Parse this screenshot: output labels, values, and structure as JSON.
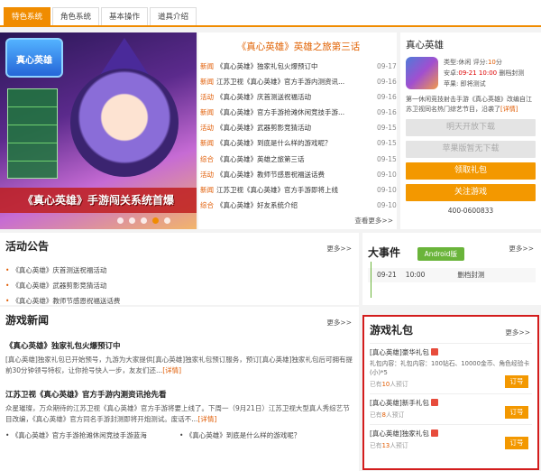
{
  "tabs": [
    "特色系统",
    "角色系统",
    "基本操作",
    "道具介绍"
  ],
  "hero": {
    "logo_text": "真心英雄",
    "banner_title": "《真心英雄》手游闯关系统首爆"
  },
  "news": {
    "headline": "《真心英雄》英雄之旅第三话",
    "items": [
      {
        "cat": "新闻",
        "title": "《真心英雄》独家礼包火爆预订中",
        "date": "09-17"
      },
      {
        "cat": "新闻",
        "title": "江苏卫视《真心英雄》官方手游内测资讯...",
        "date": "09-16"
      },
      {
        "cat": "活动",
        "title": "《真心英雄》庆首测送祝福活动",
        "date": "09-16"
      },
      {
        "cat": "新闻",
        "title": "《真心英雄》官方手游抢滩休闲竞技手游...",
        "date": "09-16"
      },
      {
        "cat": "活动",
        "title": "《真心英雄》武器剪影竞猜活动",
        "date": "09-15"
      },
      {
        "cat": "新闻",
        "title": "《真心英雄》到底是什么样的游戏呢？",
        "date": "09-15"
      },
      {
        "cat": "综合",
        "title": "《真心英雄》英雄之旅第三话",
        "date": "09-15"
      },
      {
        "cat": "活动",
        "title": "《真心英雄》教师节感恩祝福送话费",
        "date": "09-10"
      },
      {
        "cat": "新闻",
        "title": "江苏卫视《真心英雄》官方手游即将上线",
        "date": "09-10"
      },
      {
        "cat": "综合",
        "title": "《真心英雄》好友系统介绍",
        "date": "09-10"
      }
    ],
    "more": "查看更多>>"
  },
  "gameinfo": {
    "title": "真心英雄",
    "type_label": "类型:",
    "type_value": "休闲",
    "rating_label": "评分:",
    "rating_value": "10",
    "rating_unit": "分",
    "android_label": "安卓:",
    "android_date": "09-21 10:00",
    "android_status": "删档封测",
    "apple_label": "苹果:",
    "apple_status": "即将测试",
    "desc": "第一休闲竞技射击手游《真心英雄》改编自江苏卫视同名热门综艺节目，沿袭了",
    "desc_link": "[详情]",
    "btn1": "明天开放下载",
    "btn2": "苹果版暂无下载",
    "btn3": "领取礼包",
    "btn4": "关注游戏",
    "phone": "400-0600833"
  },
  "activity": {
    "title": "活动公告",
    "more": "更多>>",
    "items": [
      "《真心英雄》庆首测送祝福活动",
      "《真心英雄》武器剪影竞猜活动",
      "《真心英雄》教师节感恩祝福送话费"
    ]
  },
  "bigevent": {
    "title": "大事件",
    "more": "更多>>",
    "tag": "Android版",
    "date": "09-21",
    "time": "10:00",
    "status": "删档封测"
  },
  "gamenews": {
    "title": "游戏新闻",
    "more": "更多>>",
    "item1_title": "《真心英雄》独家礼包火爆预订中",
    "item1_body": "[真心英雄]独家礼包已开始预号，九游为大家提供[真心英雄]独家礼包预订服务，预订[真心英雄]独家礼包后可拥有提前30分钟领号特权，让你抢号快人一步，友友们还...",
    "item1_link": "[详情]",
    "item2_title": "江苏卫视《真心英雄》官方手游内测资讯抢先看",
    "item2_body": "众星璀璨，万众期待的江苏卫视《真心英雄》官方手游将要上线了。下周一（9月21日）江苏卫视大型真人秀综艺节目改编，《真心英雄》官方同名手游封测即将开炮测试。废话不...",
    "item2_link": "[详情]",
    "list1": "《真心英雄》官方手游抢滩休闲竞技手游蓝海",
    "list2": "《真心英雄》到底是什么样的游戏呢？"
  },
  "gift": {
    "title": "游戏礼包",
    "more": "更多>>",
    "items": [
      {
        "name": "[真心英雄]豪华礼包",
        "content": "礼包内容：礼包内容：100钻石、10000金币、角色经验卡(小)*5",
        "count_prefix": "已有",
        "count": "10",
        "count_suffix": "人预订",
        "button": "订号"
      },
      {
        "name": "[真心英雄]新手礼包",
        "content": "",
        "count_prefix": "已有",
        "count": "8",
        "count_suffix": "人预订",
        "button": "订号"
      },
      {
        "name": "[真心英雄]独家礼包",
        "content": "",
        "count_prefix": "已有",
        "count": "13",
        "count_suffix": "人预订",
        "button": "订号"
      }
    ]
  }
}
